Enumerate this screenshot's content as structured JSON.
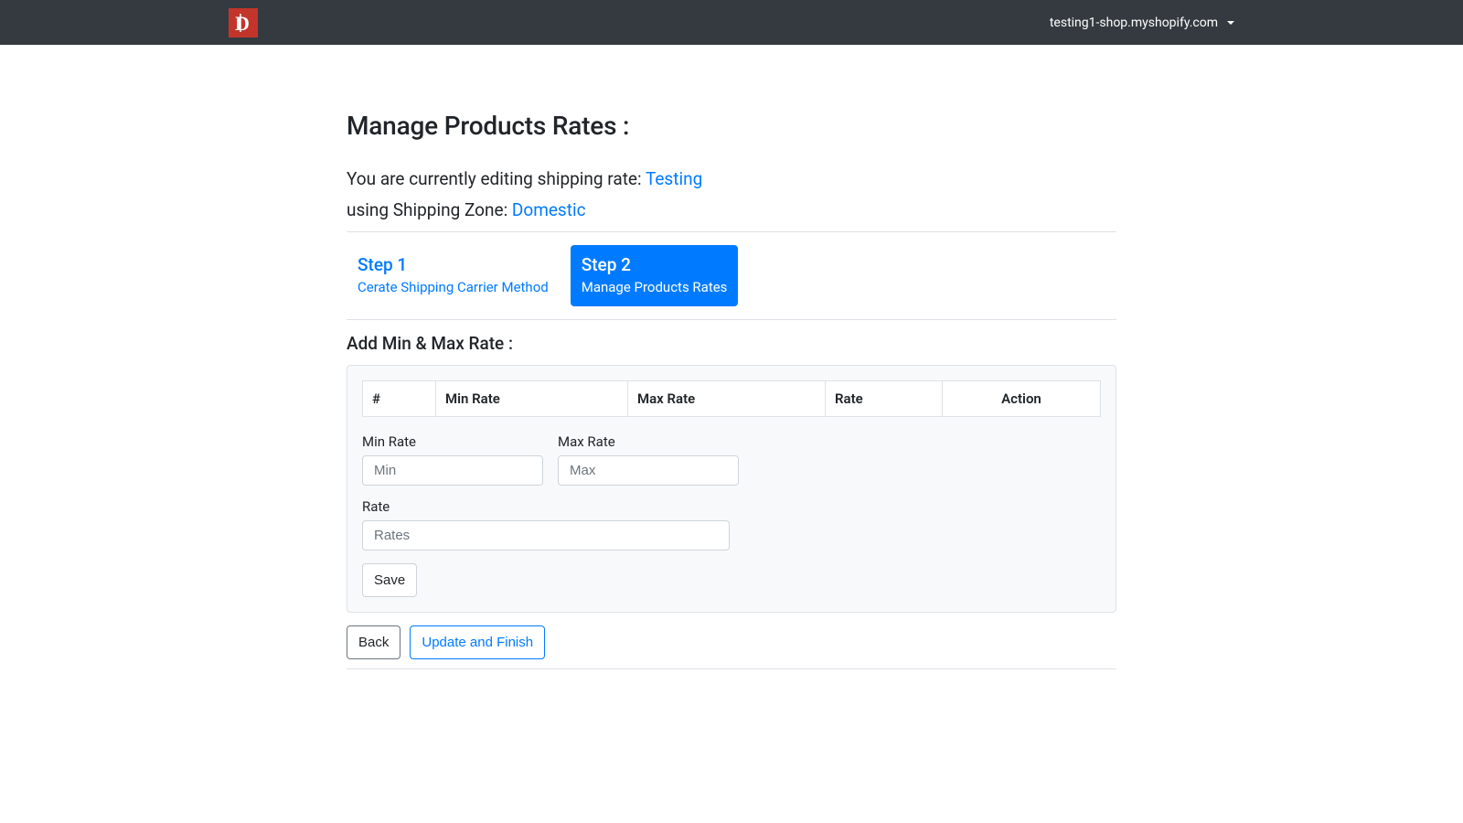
{
  "navbar": {
    "shop_domain": "testing1-shop.myshopify.com"
  },
  "page": {
    "title": "Manage Products Rates :",
    "editing_prefix": "You are currently editing shipping rate: ",
    "rate_name": "Testing",
    "zone_prefix": "using Shipping Zone: ",
    "zone_name": "Domestic"
  },
  "steps": [
    {
      "title": "Step 1",
      "desc": "Cerate Shipping Carrier Method",
      "active": false
    },
    {
      "title": "Step 2",
      "desc": "Manage Products Rates",
      "active": true
    }
  ],
  "section": {
    "title": "Add Min & Max Rate :"
  },
  "table": {
    "headers": [
      "#",
      "Min Rate",
      "Max Rate",
      "Rate",
      "Action"
    ]
  },
  "form": {
    "min_label": "Min Rate",
    "min_placeholder": "Min",
    "max_label": "Max Rate",
    "max_placeholder": "Max",
    "rate_label": "Rate",
    "rate_placeholder": "Rates",
    "save_label": "Save"
  },
  "footer": {
    "back_label": "Back",
    "finish_label": "Update and Finish"
  }
}
